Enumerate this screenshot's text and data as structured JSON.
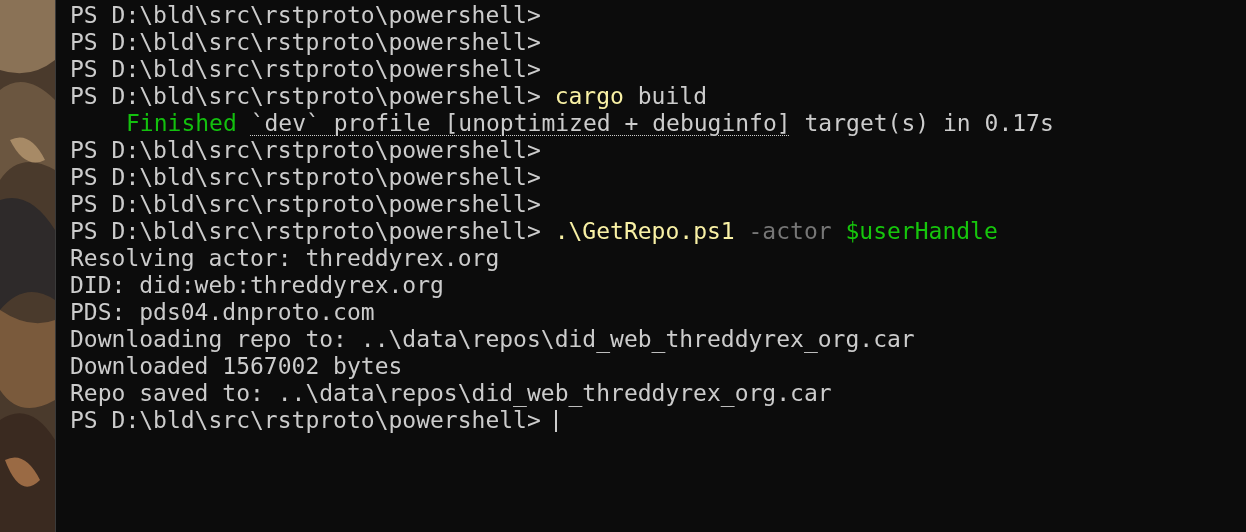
{
  "terminal": {
    "lines": [
      {
        "segments": [
          {
            "text": "PS D:\\bld\\src\\rstproto\\powershell>",
            "kind": "prompt"
          }
        ]
      },
      {
        "segments": [
          {
            "text": "PS D:\\bld\\src\\rstproto\\powershell>",
            "kind": "prompt"
          }
        ]
      },
      {
        "segments": [
          {
            "text": "PS D:\\bld\\src\\rstproto\\powershell>",
            "kind": "prompt"
          }
        ]
      },
      {
        "segments": [
          {
            "text": "PS D:\\bld\\src\\rstproto\\powershell>",
            "kind": "prompt"
          },
          {
            "text": "cargo",
            "kind": "command"
          },
          {
            "text": "build",
            "kind": "output"
          }
        ]
      },
      {
        "indent": true,
        "segments": [
          {
            "text": "Finished",
            "kind": "success"
          },
          {
            "text": "`dev` profile [unoptimized + debuginfo]",
            "kind": "link"
          },
          {
            "text": "target(s) in 0.17s",
            "kind": "output"
          }
        ]
      },
      {
        "segments": [
          {
            "text": "PS D:\\bld\\src\\rstproto\\powershell>",
            "kind": "prompt"
          }
        ]
      },
      {
        "segments": [
          {
            "text": "PS D:\\bld\\src\\rstproto\\powershell>",
            "kind": "prompt"
          }
        ]
      },
      {
        "segments": [
          {
            "text": "PS D:\\bld\\src\\rstproto\\powershell>",
            "kind": "prompt"
          }
        ]
      },
      {
        "segments": [
          {
            "text": "PS D:\\bld\\src\\rstproto\\powershell>",
            "kind": "prompt"
          },
          {
            "text": ".\\GetRepo.ps1",
            "kind": "command"
          },
          {
            "text": "-actor",
            "kind": "parameter"
          },
          {
            "text": "$userHandle",
            "kind": "variable"
          }
        ]
      },
      {
        "segments": [
          {
            "text": "Resolving actor: threddyrex.org",
            "kind": "output"
          }
        ]
      },
      {
        "segments": [
          {
            "text": "DID: did:web:threddyrex.org",
            "kind": "output"
          }
        ]
      },
      {
        "segments": [
          {
            "text": "PDS: pds04.dnproto.com",
            "kind": "output"
          }
        ]
      },
      {
        "segments": [
          {
            "text": "Downloading repo to: ..\\data\\repos\\did_web_threddyrex_org.car",
            "kind": "output"
          }
        ]
      },
      {
        "segments": [
          {
            "text": "Downloaded 1567002 bytes",
            "kind": "output"
          }
        ]
      },
      {
        "segments": [
          {
            "text": "Repo saved to: ..\\data\\repos\\did_web_threddyrex_org.car",
            "kind": "output"
          }
        ]
      },
      {
        "cursor": true,
        "segments": [
          {
            "text": "PS D:\\bld\\src\\rstproto\\powershell>",
            "kind": "prompt"
          }
        ]
      }
    ]
  }
}
